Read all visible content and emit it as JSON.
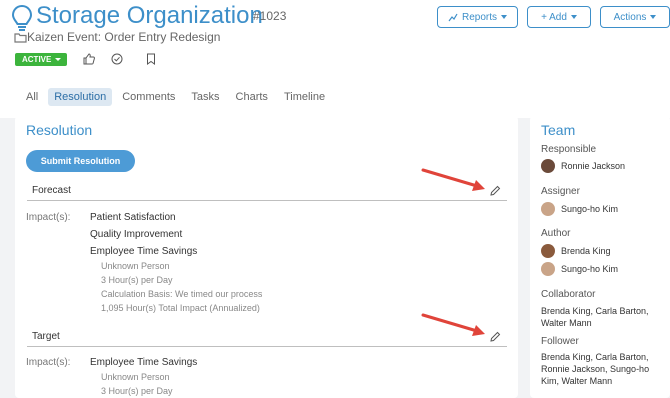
{
  "header": {
    "title": "Storage Organization",
    "ticket": "#1023",
    "breadcrumb": "Kaizen Event: Order Entry Redesign",
    "buttons": {
      "reports": "Reports",
      "add": "+ Add",
      "actions": "Actions"
    },
    "status": "ACTIVE"
  },
  "tabs": [
    "All",
    "Resolution",
    "Comments",
    "Tasks",
    "Charts",
    "Timeline"
  ],
  "resolution": {
    "title": "Resolution",
    "submit_label": "Submit Resolution",
    "forecast": {
      "label": "Forecast",
      "impacts_label": "Impact(s):",
      "impacts": [
        "Patient Satisfaction",
        "Quality Improvement",
        "Employee Time Savings"
      ],
      "details": [
        "Unknown Person",
        "3 Hour(s) per Day",
        "Calculation Basis: We timed our process",
        "1,095 Hour(s) Total Impact (Annualized)"
      ]
    },
    "target": {
      "label": "Target",
      "impacts_label": "Impact(s):",
      "impacts": [
        "Employee Time Savings"
      ],
      "details": [
        "Unknown Person",
        "3 Hour(s) per Day"
      ]
    }
  },
  "team": {
    "title": "Team",
    "responsible_label": "Responsible",
    "responsible": "Ronnie Jackson",
    "assigner_label": "Assigner",
    "assigner": "Sungo-ho Kim",
    "author_label": "Author",
    "authors": [
      "Brenda King",
      "Sungo-ho Kim"
    ],
    "collaborator_label": "Collaborator",
    "collaborators": "Brenda King, Carla Barton, Walter Mann",
    "follower_label": "Follower",
    "followers": "Brenda King, Carla Barton, Ronnie Jackson, Sungo-ho Kim, Walter Mann"
  },
  "colors": {
    "accent": "#3d8fc9",
    "status": "#3cb43c",
    "arrow": "#e0443a"
  }
}
